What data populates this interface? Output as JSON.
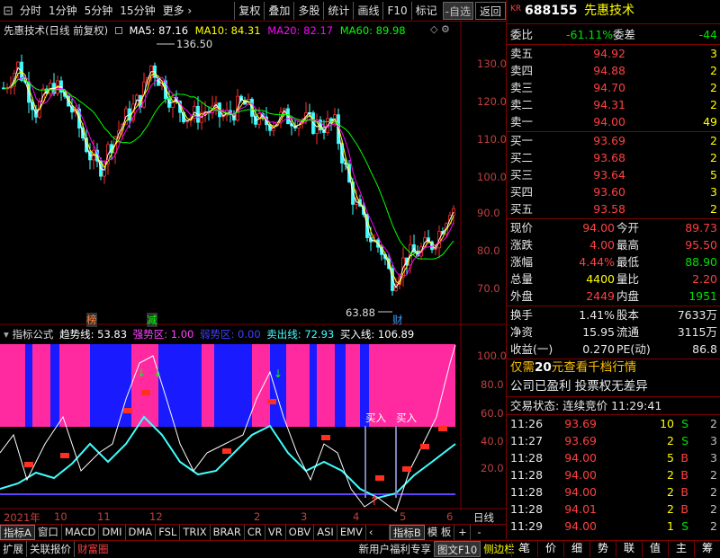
{
  "toolbar": {
    "left_items": [
      "分时",
      "1分钟",
      "5分钟",
      "15分钟",
      "更多 ›"
    ],
    "right_items": [
      "复权",
      "叠加",
      "多股",
      "统计",
      "画线",
      "F10",
      "标记",
      "-自选",
      "返回"
    ]
  },
  "chart": {
    "title": "先惠技术(日线 前复权)",
    "ma": [
      {
        "label": "MA5: 87.16",
        "color": "#ffffff"
      },
      {
        "label": "MA10: 84.31",
        "color": "#ffff00"
      },
      {
        "label": "MA20: 82.17",
        "color": "#ff00ff"
      },
      {
        "label": "MA60: 89.98",
        "color": "#00ff00"
      }
    ],
    "price_axis": [
      "130.0",
      "120.0",
      "110.0",
      "100.0",
      "90.0",
      "80.0",
      "70.0"
    ],
    "high_label": "136.50",
    "low_label": "63.88",
    "markers": {
      "bang": "榜",
      "jian": "减",
      "cai": "财"
    },
    "indicator": {
      "name": "指标公式",
      "items": [
        {
          "label": "趋势线: 53.83",
          "color": "#ffffff"
        },
        {
          "label": "强势区: 1.00",
          "color": "#ff40ff"
        },
        {
          "label": "弱势区: 0.00",
          "color": "#4040ff"
        },
        {
          "label": "卖出线: 72.93",
          "color": "#40ffff"
        },
        {
          "label": "买入线: 106.89",
          "color": "#ffffff"
        }
      ],
      "axis": [
        "100.0",
        "80.0",
        "60.0",
        "40.0",
        "20.0"
      ],
      "buy1": "买入",
      "buy2": "买入"
    },
    "date_axis": [
      "2021年",
      "10",
      "11",
      "12",
      "2",
      "3",
      "4",
      "5",
      "6"
    ],
    "date_axis_end": "日线"
  },
  "bottom_tabs": [
    "指标A",
    "窗口",
    "MACD",
    "DMI",
    "DMA",
    "FSL",
    "TRIX",
    "BRAR",
    "CR",
    "VR",
    "OBV",
    "ASI",
    "EMV",
    "‹",
    "指标B",
    "模 板",
    "+",
    "-"
  ],
  "status": {
    "left": [
      "扩展",
      "关联报价",
      "财富圈"
    ],
    "promo": "新用户福利专享",
    "mid": [
      "图文F10",
      "侧边栏 ‹"
    ],
    "tabs": [
      "笔",
      "价",
      "细",
      "势",
      "联",
      "值",
      "主",
      "筹"
    ]
  },
  "quote": {
    "kr_label": "KR",
    "code": "688155",
    "name": "先惠技术",
    "weibi_label": "委比",
    "weibi": "-61.11%",
    "weicha_label": "委差",
    "weicha": "-44",
    "asks": [
      {
        "label": "卖五",
        "price": "94.92",
        "vol": "3"
      },
      {
        "label": "卖四",
        "price": "94.88",
        "vol": "2"
      },
      {
        "label": "卖三",
        "price": "94.70",
        "vol": "2"
      },
      {
        "label": "卖二",
        "price": "94.31",
        "vol": "2"
      },
      {
        "label": "卖一",
        "price": "94.00",
        "vol": "49"
      }
    ],
    "bids": [
      {
        "label": "买一",
        "price": "93.69",
        "vol": "2"
      },
      {
        "label": "买二",
        "price": "93.68",
        "vol": "2"
      },
      {
        "label": "买三",
        "price": "93.64",
        "vol": "5"
      },
      {
        "label": "买四",
        "price": "93.60",
        "vol": "3"
      },
      {
        "label": "买五",
        "price": "93.58",
        "vol": "2"
      }
    ],
    "stats": [
      {
        "l1": "现价",
        "v1": "94.00",
        "c1": "red",
        "l2": "今开",
        "v2": "89.73",
        "c2": "red"
      },
      {
        "l1": "涨跌",
        "v1": "4.00",
        "c1": "red",
        "l2": "最高",
        "v2": "95.50",
        "c2": "red"
      },
      {
        "l1": "涨幅",
        "v1": "4.44%",
        "c1": "red",
        "l2": "最低",
        "v2": "88.90",
        "c2": "green"
      },
      {
        "l1": "总量",
        "v1": "4400",
        "c1": "yellow",
        "l2": "量比",
        "v2": "2.20",
        "c2": "red"
      },
      {
        "l1": "外盘",
        "v1": "2449",
        "c1": "red",
        "l2": "内盘",
        "v2": "1951",
        "c2": "green"
      }
    ],
    "stats2": [
      {
        "l1": "换手",
        "v1": "1.41%",
        "l2": "股本",
        "v2": "7633万"
      },
      {
        "l1": "净资",
        "v1": "15.95",
        "l2": "流通",
        "v2": "3115万"
      },
      {
        "l1": "收益(一)",
        "v1": "0.270",
        "l2": "PE(动)",
        "v2": "86.8"
      }
    ],
    "ad1": "仅需20元查看千档行情",
    "ad1_pre": "仅需",
    "ad1_num": "20",
    "ad1_post": "元查看千档行情",
    "ad2": "公司已盈利 投票权无差异",
    "trade_status": "交易状态: 连续竞价 11:29:41",
    "ticks": [
      {
        "t": "11:26",
        "p": "93.69",
        "v": "10",
        "s": "S"
      },
      {
        "t": "11:27",
        "p": "93.69",
        "v": "2",
        "s": "S"
      },
      {
        "t": "11:28",
        "p": "94.00",
        "v": "5",
        "s": "B"
      },
      {
        "t": "11:28",
        "p": "94.00",
        "v": "2",
        "s": "B"
      },
      {
        "t": "11:28",
        "p": "94.00",
        "v": "2",
        "s": "B"
      },
      {
        "t": "11:28",
        "p": "94.01",
        "v": "2",
        "s": "B"
      },
      {
        "t": "11:29",
        "p": "94.00",
        "v": "1",
        "s": "S"
      }
    ]
  }
}
